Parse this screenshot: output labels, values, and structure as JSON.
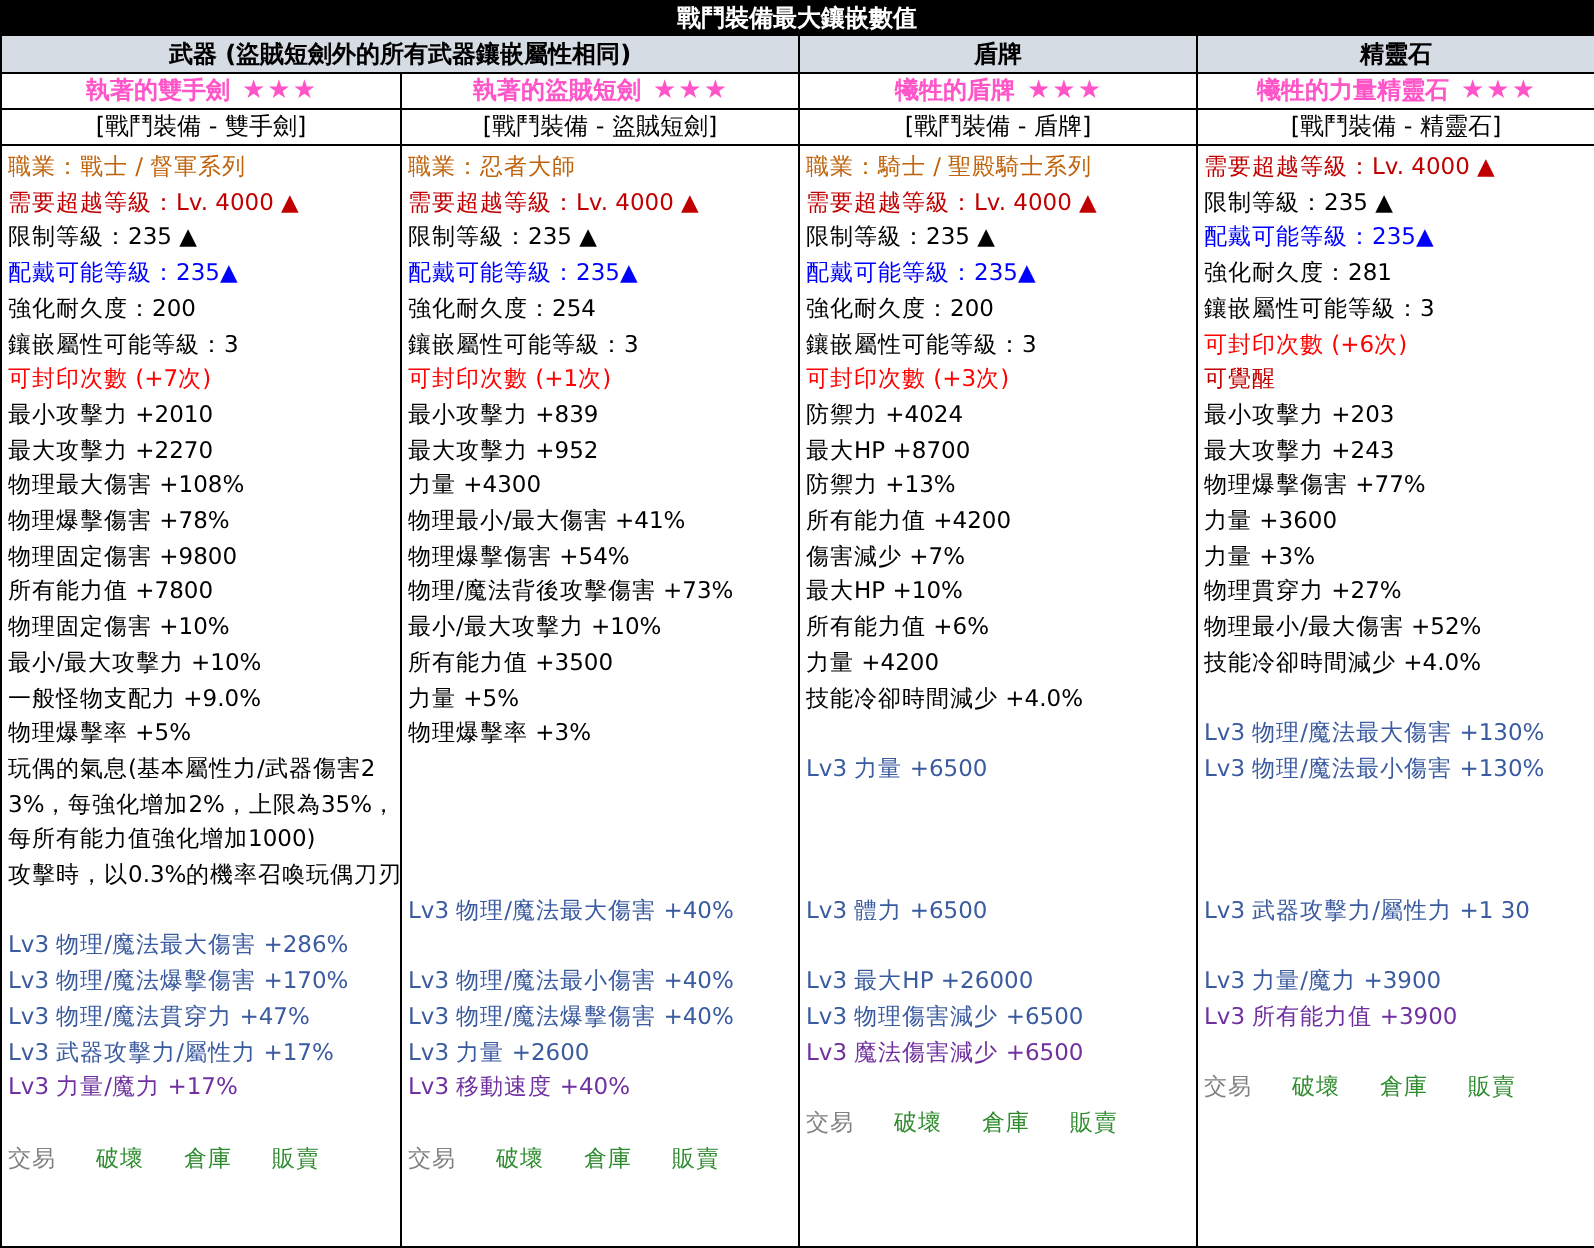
{
  "title": "戰鬥裝備最大鑲嵌數值",
  "headers": [
    {
      "text": "武器 (盜賊短劍外的所有武器鑲嵌屬性相同)",
      "kind": "merged"
    },
    {
      "text": "盾牌",
      "kind": "single"
    },
    {
      "text": "精靈石",
      "kind": "single"
    }
  ],
  "columns": [
    {
      "name": "執著的雙手劍",
      "stars": 3,
      "type": "[戰鬥裝備 - 雙手劍]",
      "lines": [
        {
          "kind": "job",
          "text": "職業：戰士 / 督軍系列"
        },
        {
          "kind": "required",
          "text": "需要超越等級：Lv. 4000 ▲"
        },
        {
          "kind": "text",
          "text": "限制等級：235 ▲"
        },
        {
          "kind": "wear",
          "text": "配戴可能等級：235▲"
        },
        {
          "kind": "text",
          "text": "強化耐久度：200"
        },
        {
          "kind": "text",
          "text": "鑲嵌屬性可能等級：3"
        },
        {
          "kind": "seal",
          "text": "可封印次數 (+7次)"
        },
        {
          "kind": "text",
          "text": "最小攻擊力 +2010"
        },
        {
          "kind": "text",
          "text": "最大攻擊力 +2270"
        },
        {
          "kind": "text",
          "text": "物理最大傷害 +108%"
        },
        {
          "kind": "text",
          "text": "物理爆擊傷害 +78%"
        },
        {
          "kind": "text",
          "text": "物理固定傷害 +9800"
        },
        {
          "kind": "text",
          "text": "所有能力值 +7800"
        },
        {
          "kind": "text",
          "text": "物理固定傷害 +10%"
        },
        {
          "kind": "text",
          "text": "最小/最大攻擊力 +10%"
        },
        {
          "kind": "text",
          "text": "一般怪物支配力 +9.0%"
        },
        {
          "kind": "text",
          "text": "物理爆擊率 +5%"
        },
        {
          "kind": "text",
          "text": "玩偶的氣息(基本屬性力/武器傷害23%，每強化增加2%，上限為35%，每所有能力值強化增加1000)"
        },
        {
          "kind": "text",
          "text": "攻擊時，以0.3%的機率召喚玩偶刀刃"
        },
        {
          "kind": "spacer"
        },
        {
          "kind": "potential",
          "text": "Lv3 物理/魔法最大傷害 +286%"
        },
        {
          "kind": "potential",
          "text": "Lv3 物理/魔法爆擊傷害 +170%"
        },
        {
          "kind": "potential",
          "text": "Lv3  物理/魔法貫穿力 +47%"
        },
        {
          "kind": "potential",
          "text": "Lv3 武器攻擊力/屬性力 +17%"
        },
        {
          "kind": "bonus",
          "text": "Lv3 力量/魔力 +17%"
        },
        {
          "kind": "spacer"
        }
      ],
      "actions": [
        {
          "label": "交易",
          "on": false
        },
        {
          "label": "破壞",
          "on": true
        },
        {
          "label": "倉庫",
          "on": true
        },
        {
          "label": "販賣",
          "on": true
        }
      ]
    },
    {
      "name": "執著的盜賊短劍",
      "stars": 3,
      "type": "[戰鬥裝備 - 盜賊短劍]",
      "lines": [
        {
          "kind": "job",
          "text": "職業：忍者大師"
        },
        {
          "kind": "required",
          "text": "需要超越等級：Lv. 4000 ▲"
        },
        {
          "kind": "text",
          "text": "限制等級：235 ▲"
        },
        {
          "kind": "wear",
          "text": "配戴可能等級：235▲"
        },
        {
          "kind": "text",
          "text": "強化耐久度：254"
        },
        {
          "kind": "text",
          "text": "鑲嵌屬性可能等級：3"
        },
        {
          "kind": "seal",
          "text": "可封印次數 (+1次)"
        },
        {
          "kind": "text",
          "text": "最小攻擊力 +839"
        },
        {
          "kind": "text",
          "text": "最大攻擊力 +952"
        },
        {
          "kind": "text",
          "text": "力量 +4300"
        },
        {
          "kind": "text",
          "text": "物理最小/最大傷害 +41%"
        },
        {
          "kind": "text",
          "text": "物理爆擊傷害 +54%"
        },
        {
          "kind": "text",
          "text": "物理/魔法背後攻擊傷害 +73%"
        },
        {
          "kind": "text",
          "text": "最小/最大攻擊力 +10%"
        },
        {
          "kind": "text",
          "text": "所有能力值 +3500"
        },
        {
          "kind": "text",
          "text": "力量 +5%"
        },
        {
          "kind": "text",
          "text": "物理爆擊率 +3%"
        },
        {
          "kind": "spacer"
        },
        {
          "kind": "spacer"
        },
        {
          "kind": "spacer"
        },
        {
          "kind": "spacer"
        },
        {
          "kind": "potential",
          "text": "Lv3 物理/魔法最大傷害 +40%"
        },
        {
          "kind": "spacer"
        },
        {
          "kind": "potential",
          "text": "Lv3 物理/魔法最小傷害 +40%"
        },
        {
          "kind": "potential",
          "text": "Lv3 物理/魔法爆擊傷害 +40%"
        },
        {
          "kind": "potential",
          "text": "Lv3 力量 +2600"
        },
        {
          "kind": "bonus",
          "text": "Lv3 移動速度 +40%"
        },
        {
          "kind": "spacer"
        }
      ],
      "actions": [
        {
          "label": "交易",
          "on": false
        },
        {
          "label": "破壞",
          "on": true
        },
        {
          "label": "倉庫",
          "on": true
        },
        {
          "label": "販賣",
          "on": true
        }
      ]
    },
    {
      "name": "犧牲的盾牌",
      "stars": 3,
      "type": "[戰鬥裝備 - 盾牌]",
      "lines": [
        {
          "kind": "job",
          "text": "職業：騎士 / 聖殿騎士系列"
        },
        {
          "kind": "required",
          "text": "需要超越等級：Lv. 4000 ▲"
        },
        {
          "kind": "text",
          "text": "限制等級：235 ▲"
        },
        {
          "kind": "wear",
          "text": "配戴可能等級：235▲"
        },
        {
          "kind": "text",
          "text": "強化耐久度：200"
        },
        {
          "kind": "text",
          "text": "鑲嵌屬性可能等級：3"
        },
        {
          "kind": "seal",
          "text": "可封印次數 (+3次)"
        },
        {
          "kind": "text",
          "text": "防禦力 +4024"
        },
        {
          "kind": "text",
          "text": "最大HP +8700"
        },
        {
          "kind": "text",
          "text": "防禦力 +13%"
        },
        {
          "kind": "text",
          "text": "所有能力值 +4200"
        },
        {
          "kind": "text",
          "text": "傷害減少 +7%"
        },
        {
          "kind": "text",
          "text": "最大HP +10%"
        },
        {
          "kind": "text",
          "text": "所有能力值 +6%"
        },
        {
          "kind": "text",
          "text": "力量 +4200"
        },
        {
          "kind": "text",
          "text": "技能冷卻時間減少 +4.0%"
        },
        {
          "kind": "spacer"
        },
        {
          "kind": "potential",
          "text": "Lv3 力量 +6500"
        },
        {
          "kind": "spacer"
        },
        {
          "kind": "spacer"
        },
        {
          "kind": "spacer"
        },
        {
          "kind": "potential",
          "text": "Lv3 體力 +6500"
        },
        {
          "kind": "spacer"
        },
        {
          "kind": "potential",
          "text": "Lv3  最大HP +26000"
        },
        {
          "kind": "potential",
          "text": "Lv3 物理傷害減少 +6500"
        },
        {
          "kind": "bonus",
          "text": "Lv3 魔法傷害減少 +6500"
        },
        {
          "kind": "spacer"
        }
      ],
      "actions": [
        {
          "label": "交易",
          "on": false
        },
        {
          "label": "破壞",
          "on": true
        },
        {
          "label": "倉庫",
          "on": true
        },
        {
          "label": "販賣",
          "on": true
        }
      ]
    },
    {
      "name": "犧牲的力量精靈石",
      "stars": 3,
      "type": "[戰鬥裝備 - 精靈石]",
      "lines": [
        {
          "kind": "required",
          "text": "需要超越等級：Lv. 4000 ▲"
        },
        {
          "kind": "text",
          "text": "限制等級：235 ▲"
        },
        {
          "kind": "wear",
          "text": "配戴可能等級：235▲"
        },
        {
          "kind": "text",
          "text": "強化耐久度：281"
        },
        {
          "kind": "text",
          "text": "鑲嵌屬性可能等級：3"
        },
        {
          "kind": "seal",
          "text": "可封印次數 (+6次)"
        },
        {
          "kind": "awaken",
          "text": "可覺醒"
        },
        {
          "kind": "text",
          "text": "最小攻擊力 +203"
        },
        {
          "kind": "text",
          "text": "最大攻擊力 +243"
        },
        {
          "kind": "text",
          "text": "物理爆擊傷害 +77%"
        },
        {
          "kind": "text",
          "text": "力量 +3600"
        },
        {
          "kind": "text",
          "text": "力量 +3%"
        },
        {
          "kind": "text",
          "text": "物理貫穿力 +27%"
        },
        {
          "kind": "text",
          "text": "物理最小/最大傷害 +52%"
        },
        {
          "kind": "text",
          "text": "技能冷卻時間減少 +4.0%"
        },
        {
          "kind": "spacer"
        },
        {
          "kind": "potential",
          "text": "Lv3 物理/魔法最大傷害 +130%"
        },
        {
          "kind": "potential",
          "text": "Lv3 物理/魔法最小傷害 +130%"
        },
        {
          "kind": "spacer"
        },
        {
          "kind": "spacer"
        },
        {
          "kind": "spacer"
        },
        {
          "kind": "potential",
          "text": "Lv3 武器攻擊力/屬性力 +1 30"
        },
        {
          "kind": "spacer"
        },
        {
          "kind": "potential",
          "text": "Lv3 力量/魔力 +3900"
        },
        {
          "kind": "bonus",
          "text": "Lv3 所有能力值 +3900"
        },
        {
          "kind": "spacer"
        }
      ],
      "actions": [
        {
          "label": "交易",
          "on": false
        },
        {
          "label": "破壞",
          "on": true
        },
        {
          "label": "倉庫",
          "on": true
        },
        {
          "label": "販賣",
          "on": true
        }
      ]
    }
  ]
}
